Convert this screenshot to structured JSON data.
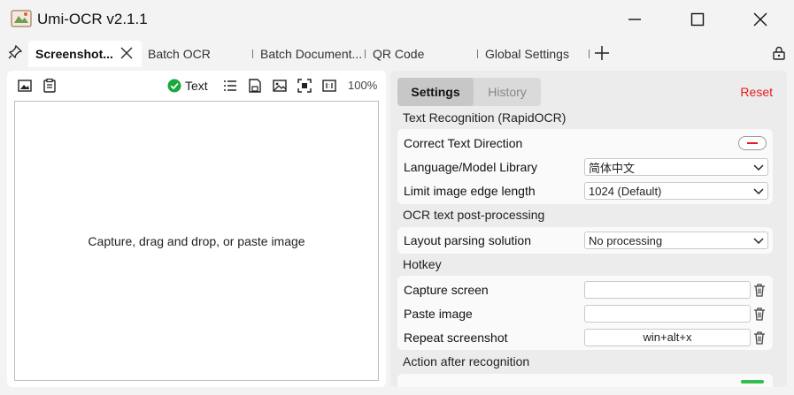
{
  "window": {
    "title": "Umi-OCR v2.1.1"
  },
  "tabs": [
    {
      "label": "Screenshot..."
    },
    {
      "label": "Batch OCR"
    },
    {
      "label": "Batch Document..."
    },
    {
      "label": "QR Code"
    },
    {
      "label": "Global Settings"
    }
  ],
  "left_toolbar": {
    "text_toggle_label": "Text",
    "zoom": "100%"
  },
  "drop_area": {
    "hint": "Capture, drag and drop, or paste image"
  },
  "right_panel": {
    "tabs": {
      "settings": "Settings",
      "history": "History"
    },
    "reset_label": "Reset",
    "groups": {
      "ocr": {
        "title": "Text Recognition (RapidOCR)",
        "correct_direction": {
          "label": "Correct Text Direction"
        },
        "language": {
          "label": "Language/Model Library",
          "value": "简体中文"
        },
        "limit_edge": {
          "label": "Limit image edge length",
          "value": "1024 (Default)"
        }
      },
      "post": {
        "title": "OCR text post-processing",
        "layout": {
          "label": "Layout parsing solution",
          "value": "No processing"
        }
      },
      "hotkey": {
        "title": "Hotkey",
        "capture": {
          "label": "Capture screen",
          "value": ""
        },
        "paste": {
          "label": "Paste image",
          "value": ""
        },
        "repeat": {
          "label": "Repeat screenshot",
          "value": "win+alt+x"
        }
      },
      "action": {
        "title": "Action after recognition"
      }
    }
  },
  "colors": {
    "accent_red": "#e81b1b",
    "toggle_green": "#1aa83a"
  }
}
